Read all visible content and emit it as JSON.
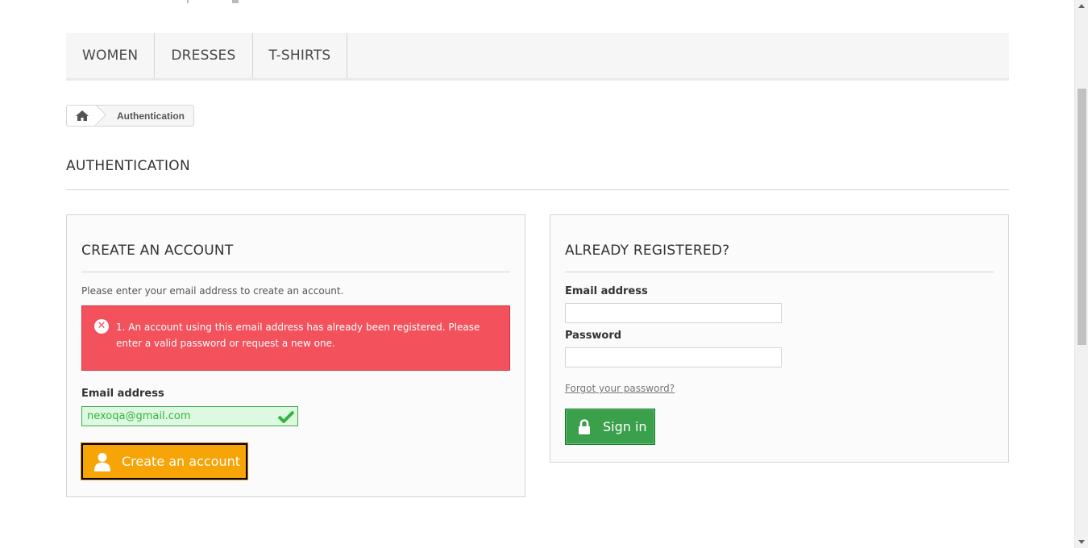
{
  "nav": {
    "items": [
      {
        "label": "WOMEN"
      },
      {
        "label": "DRESSES"
      },
      {
        "label": "T-SHIRTS"
      }
    ]
  },
  "breadcrumb": {
    "home_icon": "home-icon",
    "current": "Authentication"
  },
  "page": {
    "heading": "AUTHENTICATION"
  },
  "create_account": {
    "heading": "CREATE AN ACCOUNT",
    "intro": "Please enter your email address to create an account.",
    "error": {
      "icon": "error-circle-icon",
      "message": "1. An account using this email address has already been registered. Please enter a valid password or request a new one."
    },
    "email_label": "Email address",
    "email_value": "nexoqa@gmail.com",
    "valid_icon": "checkmark-icon",
    "button_label": "Create an account",
    "button_icon": "user-icon",
    "button_color": "#f6a406"
  },
  "sign_in": {
    "heading": "ALREADY REGISTERED?",
    "email_label": "Email address",
    "email_value": "",
    "password_label": "Password",
    "password_value": "",
    "forgot_link": "Forgot your password?",
    "button_label": "Sign in",
    "button_icon": "lock-icon",
    "button_color": "#3aa04c"
  },
  "colors": {
    "error_bg": "#f3515c",
    "valid_bg": "#ddf9e1",
    "valid_text": "#35b33f"
  }
}
